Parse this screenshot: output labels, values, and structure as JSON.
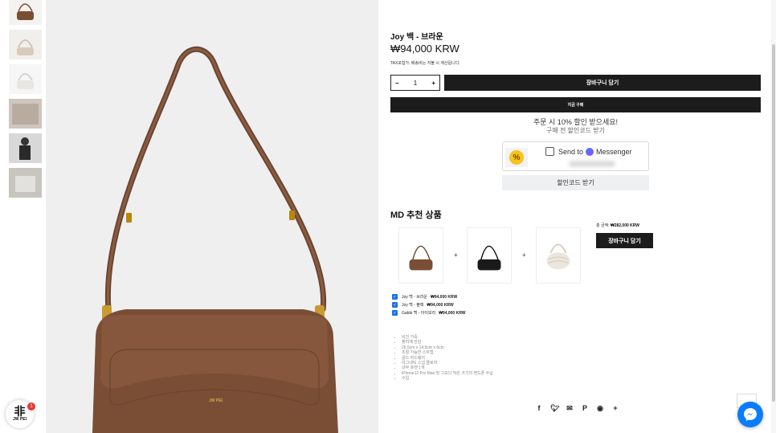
{
  "product": {
    "title": "Joy 백 - 브라운",
    "price": "₩94,000 KRW",
    "tax_note": "TAX포함가. 배송비는 지불 시 계산됩니다.",
    "quantity": "1",
    "add_to_cart": "장바구니 담기",
    "buy_now": "지금 구매"
  },
  "promo": {
    "line1": "주문 시 10% 할인 받으세요!",
    "line2": "구매 전 할인코드 받기",
    "percent_badge": "%",
    "send_to": "Send to",
    "messenger": "Messenger",
    "coupon_button": "할인코드 받기"
  },
  "md": {
    "title": "MD 추천 상품",
    "plus": "+",
    "total_label": "총 금액:",
    "total_value": "₩282,000 KRW",
    "cart_button": "장바구니 담기",
    "items": [
      {
        "label": "Joy 백 - 브라운",
        "price": "₩94,000 KRW"
      },
      {
        "label": "Joy 백 - 블랙",
        "price": "₩94,000 KRW"
      },
      {
        "label": "Gabbi 백 - 아이보리",
        "price": "₩94,000 KRW"
      }
    ]
  },
  "specs": [
    "비건 가죽",
    "폴리에 안감",
    "26.5cm x 14.5cm x 6cm",
    "조절 가능한 스트랩",
    "골드 하드웨어",
    "마그네틱 스냅 클로저",
    "내부 포켓 1개",
    "iPhone12 Pro Max 및 그보다 작은 크기의 핸드폰 수납",
    "수입"
  ],
  "share_icons": [
    "facebook-icon",
    "twitter-icon",
    "email-icon",
    "pinterest-icon",
    "messenger-icon",
    "more-icon"
  ],
  "brand": {
    "logo_mark": "非",
    "logo_text": "JW PEI",
    "notification_count": "1"
  },
  "colors": {
    "bag_brown": "#7a4e35",
    "button_black": "#1c1c1c",
    "messenger_blue": "#0a7cff"
  }
}
